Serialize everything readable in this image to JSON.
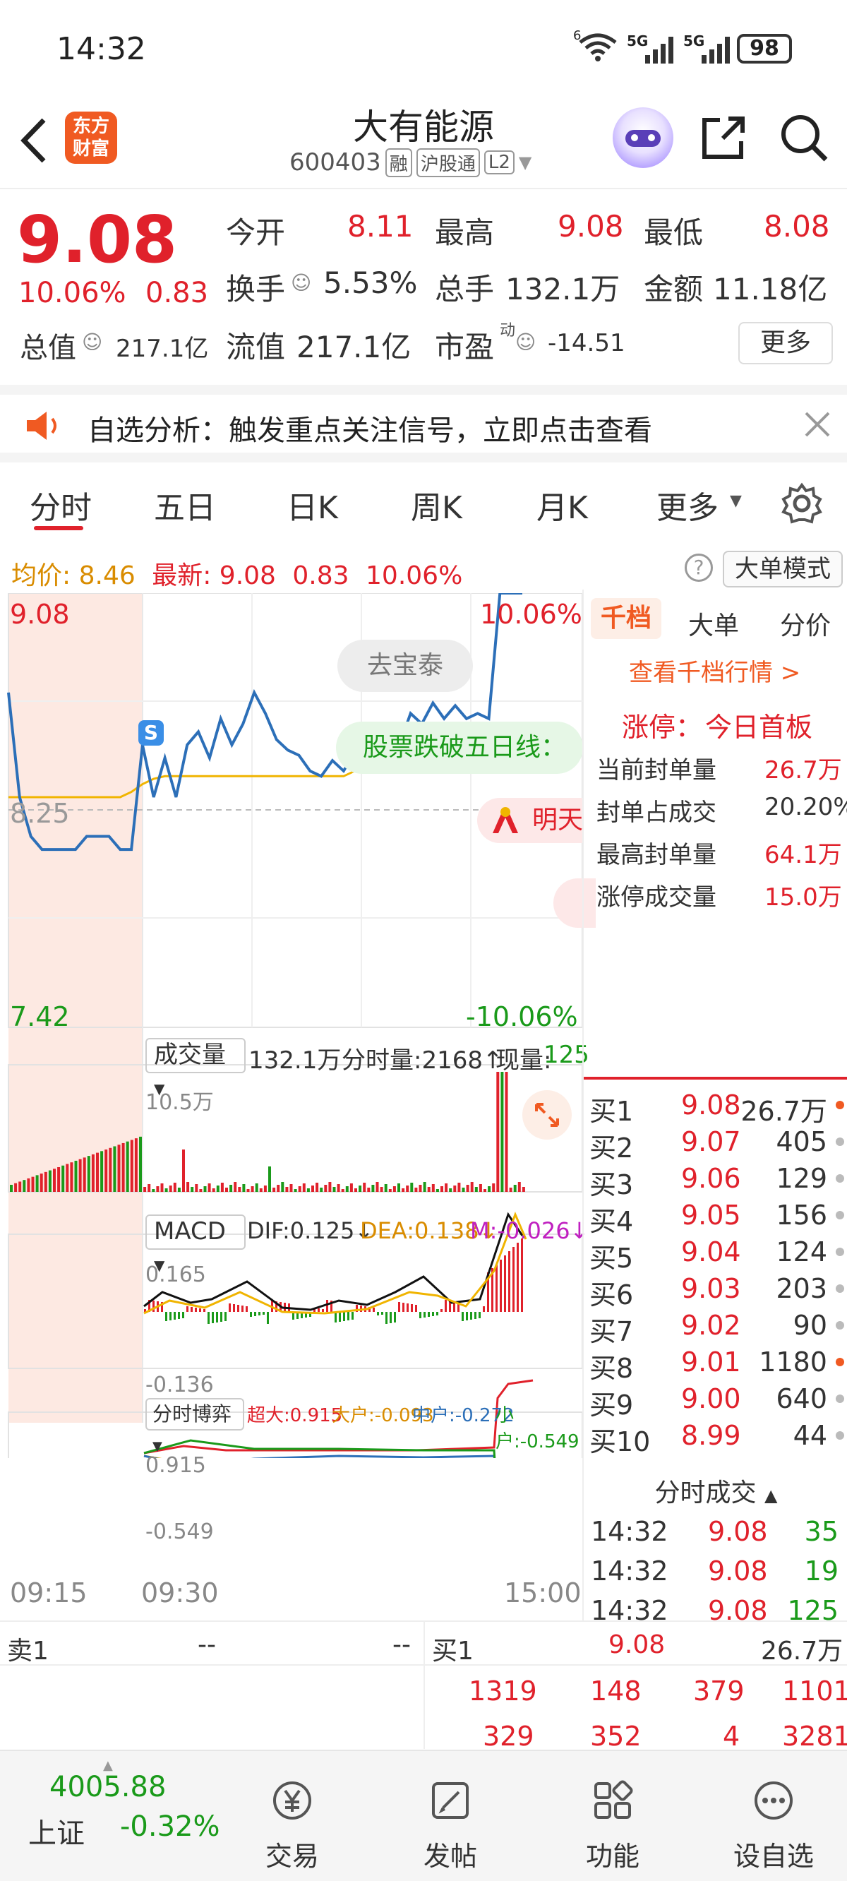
{
  "status": {
    "time": "14:32",
    "signal1": "6",
    "signal2": "5G",
    "signal3": "5G",
    "battery": "98"
  },
  "header": {
    "brand_line1": "东方",
    "brand_line2": "财富",
    "title": "大有能源",
    "code": "600403",
    "tag1": "融",
    "tag2": "沪股通",
    "tag3": "L2"
  },
  "quote": {
    "price": "9.08",
    "change_pct": "10.06%",
    "change": "0.83",
    "open_label": "今开",
    "open": "8.11",
    "high_label": "最高",
    "high": "9.08",
    "low_label": "最低",
    "low": "8.08",
    "turnover_label": "换手",
    "turnover": "5.53%",
    "volume_label": "总手",
    "volume": "132.1万",
    "amount_label": "金额",
    "amount": "11.18亿",
    "mktcap_label": "总值",
    "mktcap": "217.1亿",
    "float_label": "流值",
    "float": "217.1亿",
    "pe_label": "市盈",
    "pe_sup": "动",
    "pe": "-14.51",
    "more": "更多"
  },
  "notice": {
    "text": "自选分析：触发重点关注信号，立即点击查看"
  },
  "tabs": [
    "分时",
    "五日",
    "日K",
    "周K",
    "月K",
    "更多"
  ],
  "chart_info": {
    "avg_label": "均价:",
    "avg": "8.46",
    "latest_label": "最新:",
    "latest": "9.08",
    "chg": "0.83",
    "pct": "10.06%",
    "mode": "大单模式"
  },
  "chart": {
    "ymax": "9.08",
    "ymin": "7.42",
    "ymid": "8.25",
    "pmax": "10.06%",
    "pmin": "-10.06%",
    "bubble1": "去宝泰",
    "bubble2": "股票跌破五日线：",
    "bubble3": "明天",
    "s_marker": "S",
    "vol_label": "成交量",
    "vol_total": "132.1万",
    "vol_fs": "分时量:2168↑",
    "vol_now_label": "现量:",
    "vol_now": "125",
    "vol_max": "10.5万",
    "macd_label": "MACD",
    "dif": "DIF:0.125↓",
    "dea": "DEA:0.138↓",
    "m": "M:-0.026↓",
    "macd_max": "0.165",
    "macd_min": "-0.136",
    "bo_label": "分时博弈",
    "bo1": "超大:0.915",
    "bo2": "大户:-0.093",
    "bo3": "中户:-0.272",
    "bo4": "小户:-0.549",
    "bo_max": "0.915",
    "bo_min": "-0.549",
    "t_start": "09:15",
    "t_open": "09:30",
    "t_end": "15:00"
  },
  "chart_data": {
    "type": "line",
    "price": [
      8.7,
      8.3,
      8.15,
      8.1,
      8.1,
      8.1,
      8.1,
      8.15,
      8.15,
      8.15,
      8.1,
      8.1,
      8.5,
      8.3,
      8.45,
      8.3,
      8.5,
      8.55,
      8.45,
      8.6,
      8.5,
      8.58,
      8.7,
      8.62,
      8.52,
      8.48,
      8.46,
      8.4,
      8.38,
      8.44,
      8.4,
      8.47,
      8.45,
      8.4,
      8.46,
      8.5,
      8.62,
      8.58,
      8.66,
      8.6,
      8.65,
      8.6,
      8.62,
      8.6,
      9.08,
      9.08,
      9.08
    ],
    "avg": [
      8.3,
      8.3,
      8.3,
      8.3,
      8.3,
      8.3,
      8.3,
      8.3,
      8.3,
      8.3,
      8.3,
      8.32,
      8.35,
      8.37,
      8.38,
      8.38,
      8.38,
      8.38,
      8.38,
      8.38,
      8.38,
      8.38,
      8.38,
      8.38,
      8.38,
      8.38,
      8.38,
      8.38,
      8.38,
      8.38,
      8.38,
      8.4,
      8.41,
      8.42,
      8.42,
      8.42,
      8.42,
      8.42,
      8.42,
      8.43,
      8.43,
      8.44,
      8.44,
      8.44,
      8.45,
      8.46,
      8.46
    ],
    "ylim": [
      7.42,
      9.08
    ]
  },
  "side": {
    "tab1": "千档",
    "tab2": "大单",
    "tab3": "分价",
    "link": "查看千档行情 >",
    "limit_label": "涨停：",
    "limit_val": "今日首板",
    "r1l": "当前封单量",
    "r1v": "26.7万",
    "r2l": "封单占成交",
    "r2v": "20.20%",
    "r3l": "最高封单量",
    "r3v": "64.1万",
    "r4l": "涨停成交量",
    "r4v": "15.0万",
    "bids": [
      {
        "n": "买1",
        "p": "9.08",
        "v": "26.7万"
      },
      {
        "n": "买2",
        "p": "9.07",
        "v": "405"
      },
      {
        "n": "买3",
        "p": "9.06",
        "v": "129"
      },
      {
        "n": "买4",
        "p": "9.05",
        "v": "156"
      },
      {
        "n": "买5",
        "p": "9.04",
        "v": "124"
      },
      {
        "n": "买6",
        "p": "9.03",
        "v": "203"
      },
      {
        "n": "买7",
        "p": "9.02",
        "v": "90"
      },
      {
        "n": "买8",
        "p": "9.01",
        "v": "1180"
      },
      {
        "n": "买9",
        "p": "9.00",
        "v": "640"
      },
      {
        "n": "买10",
        "p": "8.99",
        "v": "44"
      }
    ],
    "trades_label": "分时成交",
    "trades": [
      {
        "t": "14:32",
        "p": "9.08",
        "v": "35"
      },
      {
        "t": "14:32",
        "p": "9.08",
        "v": "19"
      },
      {
        "t": "14:32",
        "p": "9.08",
        "v": "125"
      }
    ]
  },
  "bottom": {
    "sell1": "卖1",
    "sell_p": "--",
    "sell_v": "--",
    "buy1": "买1",
    "buy_p": "9.08",
    "buy_v": "26.7万",
    "q1": [
      "1319",
      "148",
      "379",
      "1101"
    ],
    "q2": [
      "329",
      "352",
      "4",
      "3281"
    ]
  },
  "nav": {
    "index_val": "4005.88",
    "index_name": "上证",
    "index_pct": "-0.32%",
    "trade": "交易",
    "post": "发帖",
    "func": "功能",
    "add": "设自选"
  }
}
